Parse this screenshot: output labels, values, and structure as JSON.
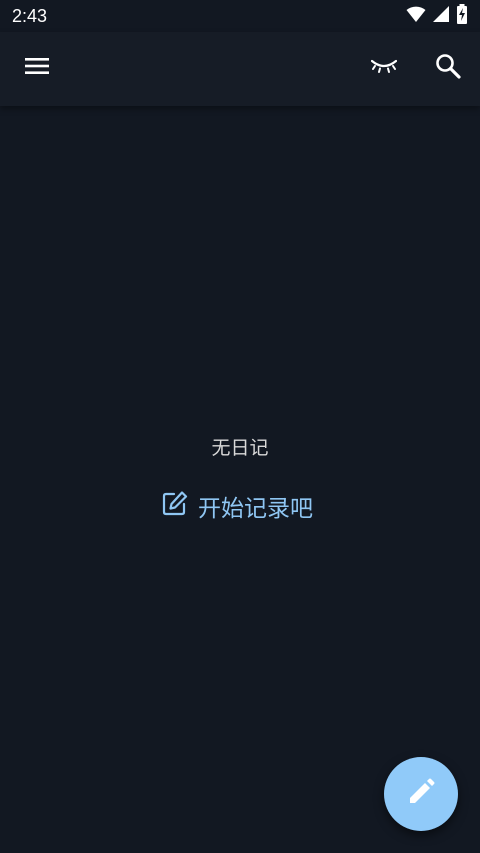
{
  "status_bar": {
    "time": "2:43",
    "icons": [
      "wifi-icon",
      "cell-signal-icon",
      "battery-charging-icon"
    ]
  },
  "app_bar": {
    "menu_icon": "menu-icon",
    "eye_icon": "eye-closed-icon",
    "search_icon": "search-icon"
  },
  "main": {
    "empty_title": "无日记",
    "start_label": "开始记录吧",
    "start_icon": "edit-icon"
  },
  "fab": {
    "icon": "pencil-icon"
  },
  "colors": {
    "background": "#121822",
    "app_bar": "#161c26",
    "accent": "#8fc6f3",
    "fab": "#90caf9"
  }
}
